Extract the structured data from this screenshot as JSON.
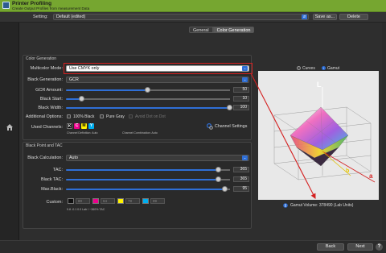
{
  "window": {
    "title": "Printer Profiling",
    "subtitle": "Create Output Profiles from measurement Data"
  },
  "setting": {
    "label": "Setting:",
    "value": "Default (edited)",
    "save_label": "Save as...",
    "delete_label": "Delete"
  },
  "tabs": [
    {
      "label": "General",
      "active": false
    },
    {
      "label": "Color Generation",
      "active": true
    }
  ],
  "color_generation": {
    "title": "Color Generation",
    "multicolor_mode": {
      "label": "Multicolor Mode:",
      "value": "Use CMYK only"
    },
    "black_generation": {
      "label": "Black Generation:",
      "value": "GCR"
    },
    "gcr_amount": {
      "label": "GCR Amount:",
      "value": "50",
      "fraction": 0.5
    },
    "black_start": {
      "label": "Black Start:",
      "value": "10",
      "fraction": 0.1
    },
    "black_width": {
      "label": "Black Width:",
      "value": "100",
      "fraction": 1.0
    },
    "additional_options": {
      "label": "Additional Options:",
      "opt1": "100% Black",
      "opt2": "Pure Gray",
      "opt3": "Avoid Dot on Dot"
    },
    "used_channels": {
      "label": "Used Channels:",
      "inks": [
        "K",
        "C",
        "M",
        "Y"
      ],
      "ink_colors": [
        "#000000",
        "#00aeef",
        "#ec008c",
        "#fff200"
      ],
      "channel_definition": "Channel Definition: Auto",
      "channel_combination": "Channel Combination: Auto",
      "settings_label": "Channel Settings"
    }
  },
  "black_point": {
    "title": "Black Point and TAC",
    "black_calculation": {
      "label": "Black Calculation:",
      "value": "Auto"
    },
    "tac": {
      "label": "TAC:",
      "value": "365",
      "fraction": 0.93
    },
    "black_tac": {
      "label": "Black TAC:",
      "value": "365",
      "fraction": 0.93
    },
    "max_black": {
      "label": "Max.Black:",
      "value": "95",
      "fraction": 0.97
    },
    "custom": {
      "label": "Custom:",
      "swatch_values": [
        "80",
        "64",
        "78",
        "89"
      ],
      "swatch_colors": [
        "#111111",
        "#ec008c",
        "#fff200",
        "#00aeef"
      ],
      "lab_note": "9.8 -0.1 0.0 Lab / ~360% TAC"
    }
  },
  "preview": {
    "curves_label": "Curves",
    "gamut_label": "Gamut",
    "selected": "Gamut",
    "axis_l": "L",
    "axis_b": "b",
    "axis_a": "a",
    "gamut_volume": "Gamut Volume: 378490 (Lab Units)"
  },
  "footer": {
    "back_label": "Back",
    "next_label": "Next",
    "help_label": "?"
  },
  "colors": {
    "accent": "#2f6fd6",
    "title_bar": "#76a630",
    "highlight": "#d42020"
  }
}
